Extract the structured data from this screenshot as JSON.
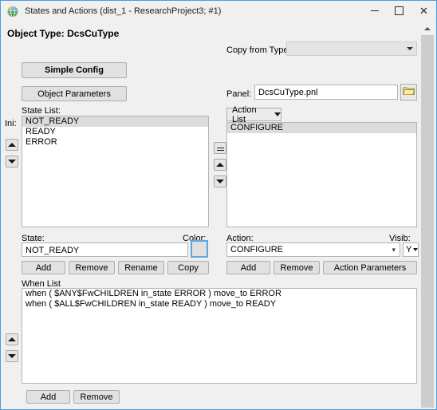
{
  "window": {
    "title": "States and Actions (dist_1 - ResearchProject3; #1)",
    "icon": "globe-icon",
    "minimize_label": "–",
    "maximize_label": "□",
    "close_label": "✕"
  },
  "header": {
    "object_type_label": "Object Type: DcsCuType"
  },
  "left": {
    "simple_config_button": "Simple Config",
    "object_parameters_button": "Object Parameters",
    "state_list_label": "State List:",
    "ini_label": "Ini:",
    "states": [
      {
        "name": "NOT_READY",
        "selected": true
      },
      {
        "name": "READY",
        "selected": false
      },
      {
        "name": "ERROR",
        "selected": false
      }
    ],
    "state_field_label": "State:",
    "state_field_value": "NOT_READY",
    "color_label": "Color:",
    "color_value": "#e0e0e0",
    "buttons": [
      "Add",
      "Remove",
      "Rename",
      "Copy"
    ],
    "spin_up": "move-state-up",
    "spin_down": "move-state-down"
  },
  "right": {
    "copy_from_type_label": "Copy from Type:",
    "copy_from_type_value": "",
    "panel_label": "Panel:",
    "panel_value": "DcsCuType.pnl",
    "browse_icon": "folder-icon",
    "action_list_button": "Action List",
    "actions": [
      {
        "name": "CONFIGURE",
        "selected": true
      }
    ],
    "action_field_label": "Action:",
    "action_field_value": "CONFIGURE",
    "visib_label": "Visib:",
    "visib_value": "Y",
    "buttons": [
      "Add",
      "Remove",
      "Action Parameters"
    ]
  },
  "middle": {
    "equals_button": "link-states-actions",
    "up_button": "move-action-up",
    "down_button": "move-action-down"
  },
  "when": {
    "label": "When List",
    "entries": [
      "when ( $ANY$FwCHILDREN in_state ERROR ) move_to ERROR",
      "when ( $ALL$FwCHILDREN in_state READY ) move_to READY"
    ],
    "buttons": [
      "Add",
      "Remove"
    ]
  },
  "colors": {
    "window_border": "#4a9de0",
    "dialog_bg": "#f0f0f0",
    "button_face": "#e1e1e1",
    "selection": "#dcdcdc",
    "scroll_track": "#cdcdcd",
    "focus_blue": "#5ba7e0",
    "folder_yellow": "#f2d14b"
  }
}
